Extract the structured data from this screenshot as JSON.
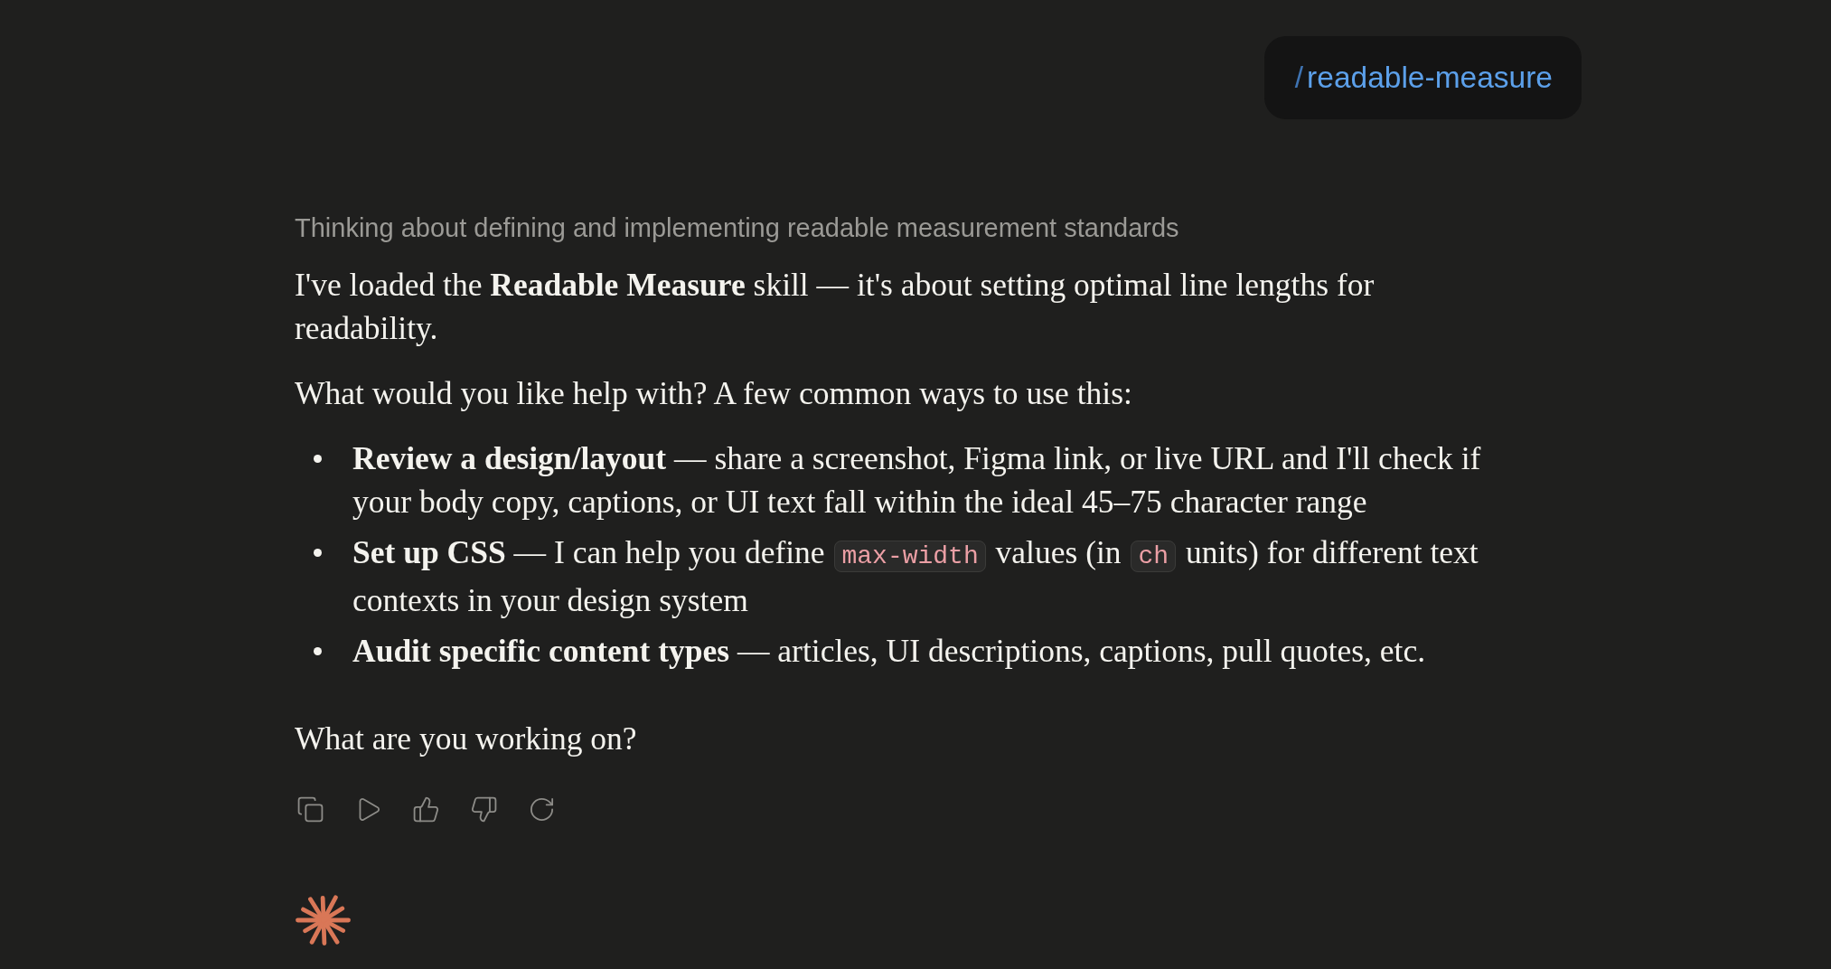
{
  "user_message": {
    "command_prefix": "/",
    "command": "readable-measure"
  },
  "assistant_message": {
    "thinking_summary": "Thinking about defining and implementing readable measurement standards",
    "paragraphs": [
      "I've loaded the **Readable Measure** skill — it's about setting optimal line lengths for readability.",
      "What would you like help with? A few common ways to use this:"
    ],
    "bullets": [
      {
        "segments": [
          {
            "kind": "text",
            "text": "**Review a design/layout** — share a screenshot, Figma link, or live URL and I'll check if your body copy, captions, or UI text fall within the ideal 45–75 character range"
          }
        ]
      },
      {
        "segments": [
          {
            "kind": "text",
            "text": "**Set up CSS** — I can help you define "
          },
          {
            "kind": "code",
            "text": "max-width"
          },
          {
            "kind": "text",
            "text": " values (in "
          },
          {
            "kind": "code",
            "text": "ch"
          },
          {
            "kind": "text",
            "text": " units) for different text contexts in your design system"
          }
        ]
      },
      {
        "segments": [
          {
            "kind": "text",
            "text": "**Audit specific content types** — articles, UI descriptions, captions, pull quotes, etc."
          }
        ]
      }
    ],
    "closing": "What are you working on?"
  }
}
